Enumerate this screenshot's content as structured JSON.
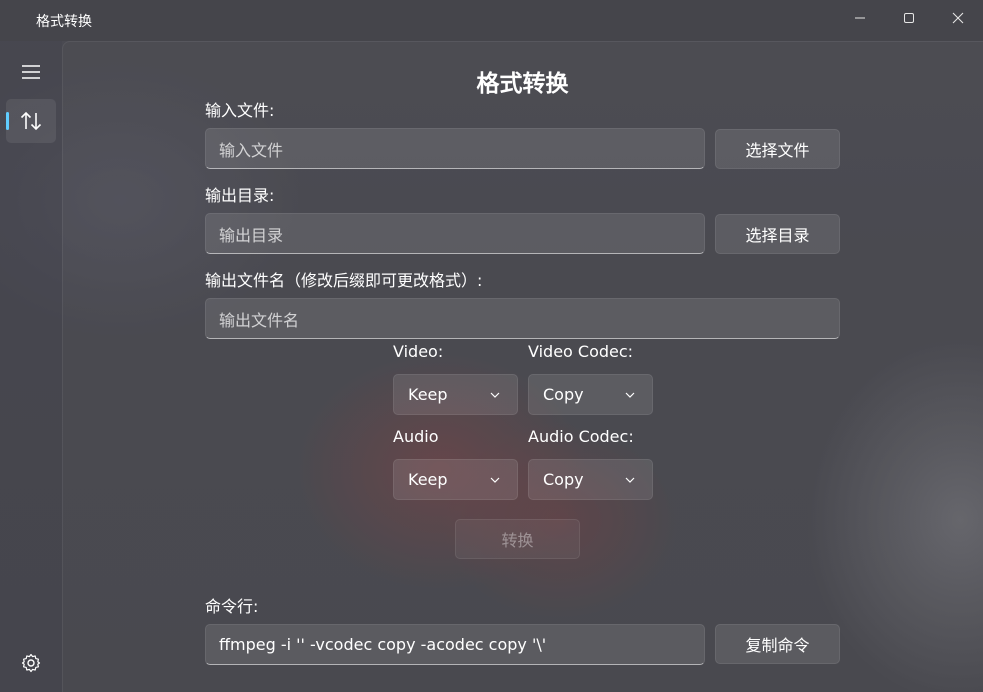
{
  "window": {
    "title": "格式转换"
  },
  "sidebar": {
    "items": [
      {
        "icon": "hamburger-menu-icon"
      },
      {
        "icon": "swap-arrows-icon",
        "selected": true
      },
      {
        "icon": "gear-icon"
      }
    ],
    "accent": "#60cdff"
  },
  "page": {
    "title": "格式转换",
    "input_file": {
      "label": "输入文件:",
      "placeholder": "输入文件",
      "button": "选择文件"
    },
    "output_dir": {
      "label": "输出目录:",
      "placeholder": "输出目录",
      "button": "选择目录"
    },
    "output_name": {
      "label": "输出文件名（修改后缀即可更改格式）:",
      "placeholder": "输出文件名"
    },
    "video": {
      "label": "Video:",
      "value": "Keep"
    },
    "video_codec": {
      "label": "Video Codec:",
      "value": "Copy"
    },
    "audio": {
      "label": "Audio",
      "value": "Keep"
    },
    "audio_codec": {
      "label": "Audio Codec:",
      "value": "Copy"
    },
    "convert_button": "转换",
    "command": {
      "label": "命令行:",
      "value": "ffmpeg -i ''  -vcodec copy  -acodec copy '\\'",
      "copy_button": "复制命令"
    }
  }
}
